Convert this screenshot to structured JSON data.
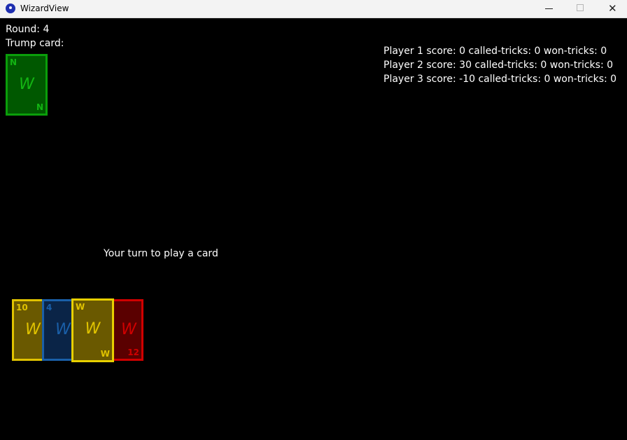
{
  "window": {
    "title": "WizardView",
    "close_glyph": "✕"
  },
  "game": {
    "round_text": "Round: 4",
    "trump_label": "Trump card:",
    "status_text": "Your turn to play a card",
    "trump_card": {
      "top": "N",
      "center": "W",
      "bottom": "N",
      "color": "#13b513"
    },
    "scores": [
      "Player 1 score: 0   called-tricks: 0   won-tricks: 0",
      "Player 2 score: 30   called-tricks: 0   won-tricks: 0",
      "Player 3 score: -10   called-tricks: 0   won-tricks: 0"
    ],
    "hand": [
      {
        "top": "10",
        "center": "W",
        "bottom": "",
        "color": "#e0c300"
      },
      {
        "top": "4",
        "center": "W",
        "bottom": "",
        "color": "#1a5fa8"
      },
      {
        "top": "W",
        "center": "W",
        "bottom": "W",
        "color": "#e0c300"
      },
      {
        "top": "",
        "center": "W",
        "bottom": "12",
        "color": "#d00000"
      }
    ]
  },
  "icons": {
    "app": "app-icon",
    "minimize": "minimize-icon",
    "maximize": "maximize-icon",
    "close": "close-icon"
  }
}
